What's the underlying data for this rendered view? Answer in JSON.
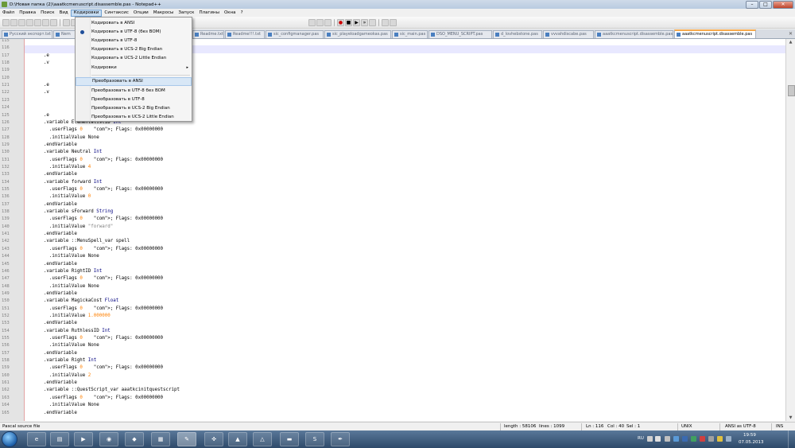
{
  "window": {
    "title": "D:\\Новая папка (2)\\aaatkcmenuscript.disassemble.pas - Notepad++"
  },
  "menubar": [
    "Файл",
    "Правка",
    "Поиск",
    "Вид",
    "Кодировки",
    "Синтаксис",
    "Опции",
    "Макросы",
    "Запуск",
    "Плагины",
    "Окна",
    "?"
  ],
  "tabs": [
    "Русский экспорт.txt",
    "Nem",
    "Readme.txt",
    "Readme!!!.txt",
    "sic_configmanager.pas",
    "sic_playeloadgameokas.pas",
    "sic_main.pas",
    "DSO_MENU_SCRIPT.pas",
    "d_lovhebstone.pas",
    "vvvahdiscabe.pas",
    "aaatkcmenuscript.disassemble.pas",
    "aaatkcmenuscript.disassemble.pas"
  ],
  "encoding_menu": {
    "items": [
      "Кодировать в ANSI",
      "Кодировать в UTF-8 (без BOM)",
      "Кодировать в UTF-8",
      "Кодировать в UCS-2 Big Endian",
      "Кодировать в UCS-2 Little Endian",
      "Кодировки",
      "Преобразовать в ANSI",
      "Преобразовать в UTF-8 без BOM",
      "Преобразовать в UTF-8",
      "Преобразовать в UCS-2 Big Endian",
      "Преобразовать в UCS-2 Little Endian"
    ]
  },
  "editor": {
    "lines": [
      {
        "n": "115",
        "t": ""
      },
      {
        "n": "116",
        "t": ""
      },
      {
        "n": "117",
        "t": "      .e"
      },
      {
        "n": "118",
        "t": "      .v"
      },
      {
        "n": "119",
        "t": "                                      0"
      },
      {
        "n": "120",
        "t": ""
      },
      {
        "n": "121",
        "t": "      .e"
      },
      {
        "n": "122",
        "t": "      .v"
      },
      {
        "n": "123",
        "t": "                                      0"
      },
      {
        "n": "124",
        "t": ""
      },
      {
        "n": "125",
        "t": "      .e"
      },
      {
        "n": "126",
        "t": "      .variable ElementalistID Int"
      },
      {
        "n": "127",
        "t": "        .userFlags 0    ; Flags: 0x00000000"
      },
      {
        "n": "128",
        "t": "        .initialValue None"
      },
      {
        "n": "129",
        "t": "      .endVariable"
      },
      {
        "n": "130",
        "t": "      .variable Neutral Int"
      },
      {
        "n": "131",
        "t": "        .userFlags 0    ; Flags: 0x00000000"
      },
      {
        "n": "132",
        "t": "        .initialValue 4"
      },
      {
        "n": "133",
        "t": "      .endVariable"
      },
      {
        "n": "134",
        "t": "      .variable forward Int"
      },
      {
        "n": "135",
        "t": "        .userFlags 0    ; Flags: 0x00000000"
      },
      {
        "n": "136",
        "t": "        .initialValue 0"
      },
      {
        "n": "137",
        "t": "      .endVariable"
      },
      {
        "n": "138",
        "t": "      .variable sForward String"
      },
      {
        "n": "139",
        "t": "        .userFlags 0    ; Flags: 0x00000000"
      },
      {
        "n": "140",
        "t": "        .initialValue \"forward\""
      },
      {
        "n": "141",
        "t": "      .endVariable"
      },
      {
        "n": "142",
        "t": "      .variable ::MenuSpell_var spell"
      },
      {
        "n": "143",
        "t": "        .userFlags 0    ; Flags: 0x00000000"
      },
      {
        "n": "144",
        "t": "        .initialValue None"
      },
      {
        "n": "145",
        "t": "      .endVariable"
      },
      {
        "n": "146",
        "t": "      .variable RightID Int"
      },
      {
        "n": "147",
        "t": "        .userFlags 0    ; Flags: 0x00000000"
      },
      {
        "n": "148",
        "t": "        .initialValue None"
      },
      {
        "n": "149",
        "t": "      .endVariable"
      },
      {
        "n": "150",
        "t": "      .variable MagickaCost Float"
      },
      {
        "n": "151",
        "t": "        .userFlags 0    ; Flags: 0x00000000"
      },
      {
        "n": "152",
        "t": "        .initialValue 1.000000"
      },
      {
        "n": "153",
        "t": "      .endVariable"
      },
      {
        "n": "154",
        "t": "      .variable RuthlessID Int"
      },
      {
        "n": "155",
        "t": "        .userFlags 0    ; Flags: 0x00000000"
      },
      {
        "n": "156",
        "t": "        .initialValue None"
      },
      {
        "n": "157",
        "t": "      .endVariable"
      },
      {
        "n": "158",
        "t": "      .variable Right Int"
      },
      {
        "n": "159",
        "t": "        .userFlags 0    ; Flags: 0x00000000"
      },
      {
        "n": "160",
        "t": "        .initialValue 2"
      },
      {
        "n": "161",
        "t": "      .endVariable"
      },
      {
        "n": "162",
        "t": "      .variable ::QuestScript_var aaatkcinitquestscript"
      },
      {
        "n": "163",
        "t": "        .userFlags 0    ; Flags: 0x00000000"
      },
      {
        "n": "164",
        "t": "        .initialValue None"
      },
      {
        "n": "165",
        "t": "      .endVariable"
      }
    ]
  },
  "statusbar": {
    "filetype": "Pascal source file",
    "length": "length : 58106",
    "lines": "lines : 1099",
    "pos": "Ln : 116",
    "col": "Col : 40",
    "sel": "Sel : 1",
    "eol": "UNIX",
    "encoding": "ANSI as UTF-8",
    "ins": "INS"
  },
  "taskbar": {
    "lang": "RU",
    "time": "19:59",
    "date": "07.05.2013"
  },
  "colors": {
    "keyword": "#00007f",
    "number": "#ff8000",
    "comment": "#008000",
    "string": "#808080",
    "current_line": "#e8e8ff",
    "active_tab": "#f6a84a"
  }
}
